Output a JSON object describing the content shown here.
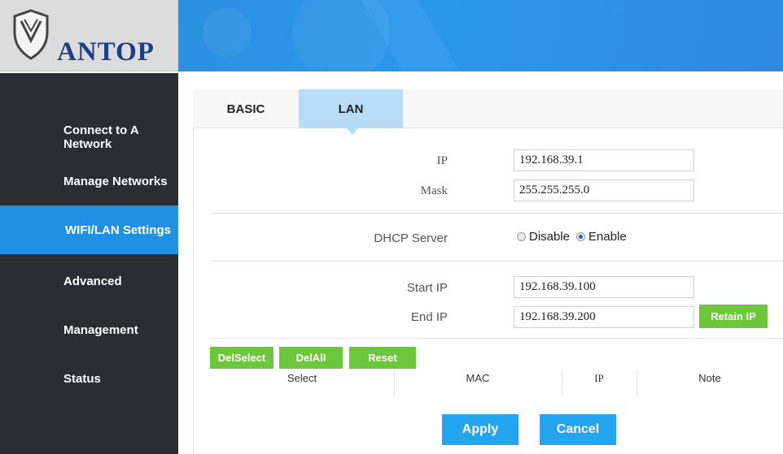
{
  "brand": {
    "name": "ANTOP"
  },
  "sidebar": {
    "items": [
      {
        "label": "Connect to A Network",
        "active": false
      },
      {
        "label": "Manage Networks",
        "active": false
      },
      {
        "label": "WIFI/LAN Settings",
        "active": true
      },
      {
        "label": "Advanced",
        "active": false
      },
      {
        "label": "Management",
        "active": false
      },
      {
        "label": "Status",
        "active": false
      }
    ]
  },
  "tabs": [
    {
      "label": "BASIC",
      "active": false
    },
    {
      "label": "LAN",
      "active": true
    }
  ],
  "form": {
    "ip": {
      "label": "IP",
      "value": "192.168.39.1"
    },
    "mask": {
      "label": "Mask",
      "value": "255.255.255.0"
    },
    "dhcp": {
      "label": "DHCP Server",
      "options": [
        "Disable",
        "Enable"
      ],
      "selected": "Enable"
    },
    "start_ip": {
      "label": "Start IP",
      "value": "192.168.39.100"
    },
    "end_ip": {
      "label": "End IP",
      "value": "192.168.39.200"
    },
    "retain_ip_label": "Retain IP"
  },
  "table": {
    "buttons": [
      "DelSelect",
      "DelAll",
      "Reset"
    ],
    "headers": [
      "Select",
      "MAC",
      "IP",
      "Note"
    ]
  },
  "actions": {
    "apply": "Apply",
    "cancel": "Cancel"
  },
  "colors": {
    "accent": "#2090e3",
    "green": "#6cc83a",
    "sidebar": "#2a2e33",
    "tab_active": "#b8ddf7"
  }
}
